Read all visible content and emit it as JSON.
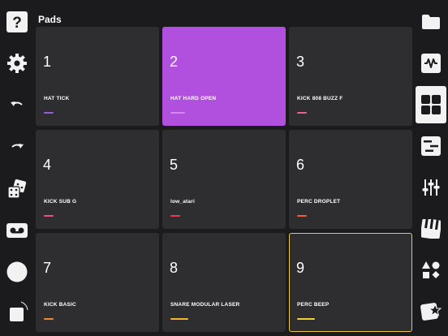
{
  "header": {
    "title": "Pads"
  },
  "left_toolbar": [
    {
      "icon": "help-icon"
    },
    {
      "icon": "gear-icon"
    },
    {
      "icon": "undo-icon"
    },
    {
      "icon": "redo-icon"
    },
    {
      "icon": "dice-icon"
    },
    {
      "icon": "tape-icon"
    },
    {
      "icon": "record-icon"
    },
    {
      "icon": "stop-icon"
    }
  ],
  "right_toolbar": [
    {
      "icon": "folder-icon",
      "active": false
    },
    {
      "icon": "waveform-icon",
      "active": false
    },
    {
      "icon": "pads-grid-icon",
      "active": true
    },
    {
      "icon": "sequencer-icon",
      "active": false
    },
    {
      "icon": "mixer-sliders-icon",
      "active": false
    },
    {
      "icon": "piano-keys-icon",
      "active": false
    },
    {
      "icon": "shapes-icon",
      "active": false
    },
    {
      "icon": "fx-star-icon",
      "active": false
    }
  ],
  "pads": [
    {
      "number": "1",
      "name": "HAT TICK",
      "color": "#9b59e3",
      "selected": false,
      "highlighted": false
    },
    {
      "number": "2",
      "name": "HAT HARD OPEN",
      "color": "#d48ae8",
      "selected": true,
      "highlighted": false
    },
    {
      "number": "3",
      "name": "KICK 808 BUZZ F",
      "color": "#f0608c",
      "selected": false,
      "highlighted": false
    },
    {
      "number": "4",
      "name": "KICK SUB G",
      "color": "#f05080",
      "selected": false,
      "highlighted": false
    },
    {
      "number": "5",
      "name": "low_atari",
      "color": "#e0404a",
      "selected": false,
      "highlighted": false
    },
    {
      "number": "6",
      "name": "PERC DROPLET",
      "color": "#f06038",
      "selected": false,
      "highlighted": false
    },
    {
      "number": "7",
      "name": "KICK BASIC",
      "color": "#f08a30",
      "selected": false,
      "highlighted": false
    },
    {
      "number": "8",
      "name": "SNARE MODULAR LASER",
      "color": "#f0b830",
      "selected": false,
      "highlighted": false
    },
    {
      "number": "9",
      "name": "PERC BEEP",
      "color": "#f0d030",
      "selected": false,
      "highlighted": true
    }
  ],
  "colors": {
    "selected_pad_bg": "#b150de",
    "pad_bg": "#2e2e31",
    "highlight_border": "#e8c84a",
    "app_bg": "#1b1b1d"
  }
}
